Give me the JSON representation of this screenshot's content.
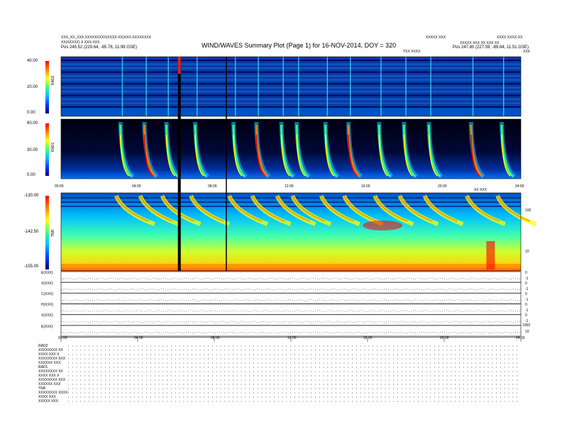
{
  "header": {
    "title": "WIND/WAVES Summary Plot (Page 1) for 16-NOV-2014, DOY = 320",
    "left_lines": [
      "XXX_XX_XXX,XXXXXXXXX(XXXX-XX)XXX-XXXXXXXX",
      "XX(XXXXX) X XXX-XXX",
      "Pos  245.52 (229.64, -85.76, 11.99 GSE)"
    ],
    "right_lines": [
      "XXXXX XXX",
      "XXXX XXXX-XX",
      "XXXXX XXX XX XXX XX",
      "Pos  247.80 (227.59, -89.84, 11.51 GSE)"
    ],
    "center_tag": "TXX XXXX",
    "right_tag": "XXX"
  },
  "panels": {
    "rad2": {
      "label": "RAD2",
      "ticks": [
        "40.00",
        "20.00",
        "0.00"
      ]
    },
    "rad1": {
      "label": "RAD1",
      "ticks": [
        "60.00",
        "30.00",
        "0.00"
      ]
    },
    "tnr": {
      "label": "TNR",
      "ticks": [
        "-130.00",
        "-142.50",
        "-155.00"
      ],
      "right_ticks": [
        "100",
        "10"
      ],
      "right_tag": "XX XXX"
    },
    "time_ticks": [
      "00:00",
      "04:00",
      "08:00",
      "12:00",
      "16:00",
      "20:00",
      "24:00"
    ]
  },
  "line_plots": {
    "labels": [
      "E(XXX)",
      "X(XXX)",
      "C(XXX)",
      "H(XXX)",
      "X(XXX)",
      "E(XXX)"
    ],
    "right_ticks": [
      [
        "0",
        "-1"
      ],
      [
        "0",
        "-1"
      ],
      [
        "0",
        "-1"
      ],
      [
        "0",
        "-1"
      ],
      [
        "0",
        "-1"
      ],
      [
        "1000",
        "10"
      ]
    ]
  },
  "footer": {
    "blocks": [
      {
        "head": "RAD2",
        "rows": [
          "XXXXXXXX  XX",
          "XXXX  XXX X",
          "XXXXXXXX XXX",
          "XXXXXX  XXX"
        ]
      },
      {
        "head": "RAD1",
        "rows": [
          "XXXXXXXX  XX",
          "XXXX  XXX X",
          "XXXXXXXX XXX",
          "XXXXXX  XXX"
        ]
      },
      {
        "head": "TNR",
        "rows": [
          "XXXXXXXX  XXXX",
          "XXXX  XXX",
          "XXXXX  XXX"
        ]
      }
    ]
  },
  "chart_data": {
    "type": "heatmap",
    "title": "WIND/WAVES Summary Plot (Page 1) for 16-NOV-2014, DOY = 320",
    "x_range_hours": [
      0,
      24
    ],
    "colorscale": [
      "#000080",
      "#0040ff",
      "#00c0ff",
      "#40ff80",
      "#ffff00",
      "#ff8000",
      "#ff0000"
    ],
    "bursts_hours": [
      3.1,
      4.35,
      5.5,
      7.0,
      9.0,
      10.2,
      11.5,
      12.3,
      13.8,
      15.0,
      16.6,
      17.9,
      19.2,
      21.4,
      23.0
    ],
    "data_gaps_hours": [
      6.1,
      8.6
    ],
    "panels": [
      {
        "name": "RAD2",
        "ylim": [
          0,
          40
        ]
      },
      {
        "name": "RAD1",
        "ylim": [
          0,
          60
        ]
      },
      {
        "name": "TNR",
        "ylim": [
          -155,
          -130
        ]
      }
    ]
  }
}
